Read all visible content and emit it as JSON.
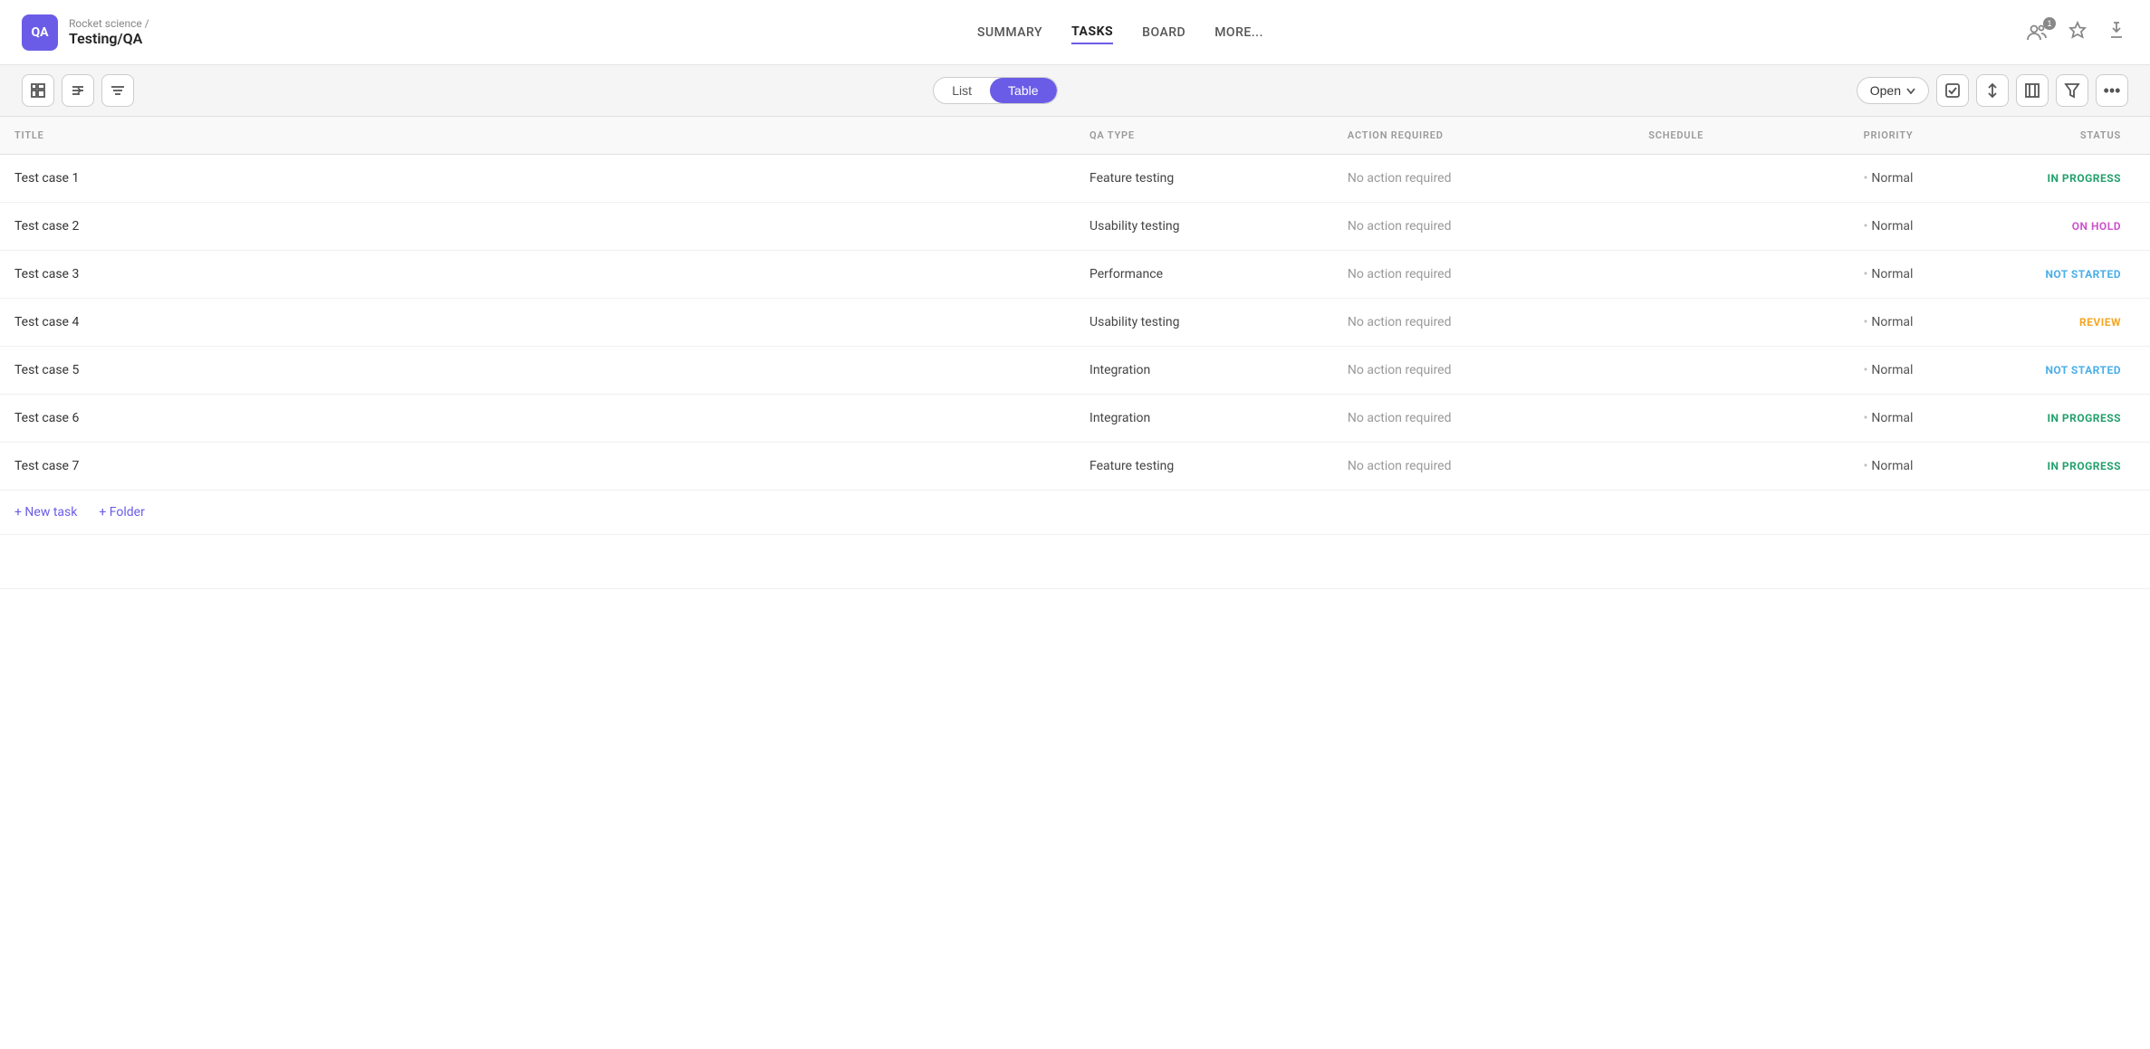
{
  "header": {
    "logo_text": "QA",
    "breadcrumb_parent": "Rocket science /",
    "breadcrumb_current": "Testing/QA",
    "nav_tabs": [
      {
        "id": "summary",
        "label": "SUMMARY",
        "active": false
      },
      {
        "id": "tasks",
        "label": "TASKS",
        "active": true
      },
      {
        "id": "board",
        "label": "BOARD",
        "active": false
      },
      {
        "id": "more",
        "label": "MORE...",
        "active": false
      }
    ]
  },
  "toolbar": {
    "view_list_label": "List",
    "view_table_label": "Table",
    "open_label": "Open",
    "active_view": "table"
  },
  "table": {
    "columns": [
      {
        "id": "title",
        "label": "TITLE"
      },
      {
        "id": "qatype",
        "label": "QA TYPE"
      },
      {
        "id": "action",
        "label": "ACTION REQUIRED"
      },
      {
        "id": "schedule",
        "label": "SCHEDULE"
      },
      {
        "id": "priority",
        "label": "PRIORITY"
      },
      {
        "id": "status",
        "label": "STATUS"
      }
    ],
    "rows": [
      {
        "id": 1,
        "title": "Test case 1",
        "qatype": "Feature testing",
        "action": "No action required",
        "schedule": "",
        "priority": "Normal",
        "status": "IN PROGRESS",
        "status_class": "status-in-progress"
      },
      {
        "id": 2,
        "title": "Test case 2",
        "qatype": "Usability testing",
        "action": "No action required",
        "schedule": "",
        "priority": "Normal",
        "status": "ON HOLD",
        "status_class": "status-on-hold"
      },
      {
        "id": 3,
        "title": "Test case 3",
        "qatype": "Performance",
        "action": "No action required",
        "schedule": "",
        "priority": "Normal",
        "status": "NOT STARTED",
        "status_class": "status-not-started"
      },
      {
        "id": 4,
        "title": "Test case 4",
        "qatype": "Usability testing",
        "action": "No action required",
        "schedule": "",
        "priority": "Normal",
        "status": "REVIEW",
        "status_class": "status-review"
      },
      {
        "id": 5,
        "title": "Test case 5",
        "qatype": "Integration",
        "action": "No action required",
        "schedule": "",
        "priority": "Normal",
        "status": "NOT STARTED",
        "status_class": "status-not-started"
      },
      {
        "id": 6,
        "title": "Test case 6",
        "qatype": "Integration",
        "action": "No action required",
        "schedule": "",
        "priority": "Normal",
        "status": "IN PROGRESS",
        "status_class": "status-in-progress"
      },
      {
        "id": 7,
        "title": "Test case 7",
        "qatype": "Feature testing",
        "action": "No action required",
        "schedule": "",
        "priority": "Normal",
        "status": "IN PROGRESS",
        "status_class": "status-in-progress"
      }
    ],
    "footer": {
      "new_task_label": "+ New task",
      "new_folder_label": "+ Folder"
    }
  }
}
